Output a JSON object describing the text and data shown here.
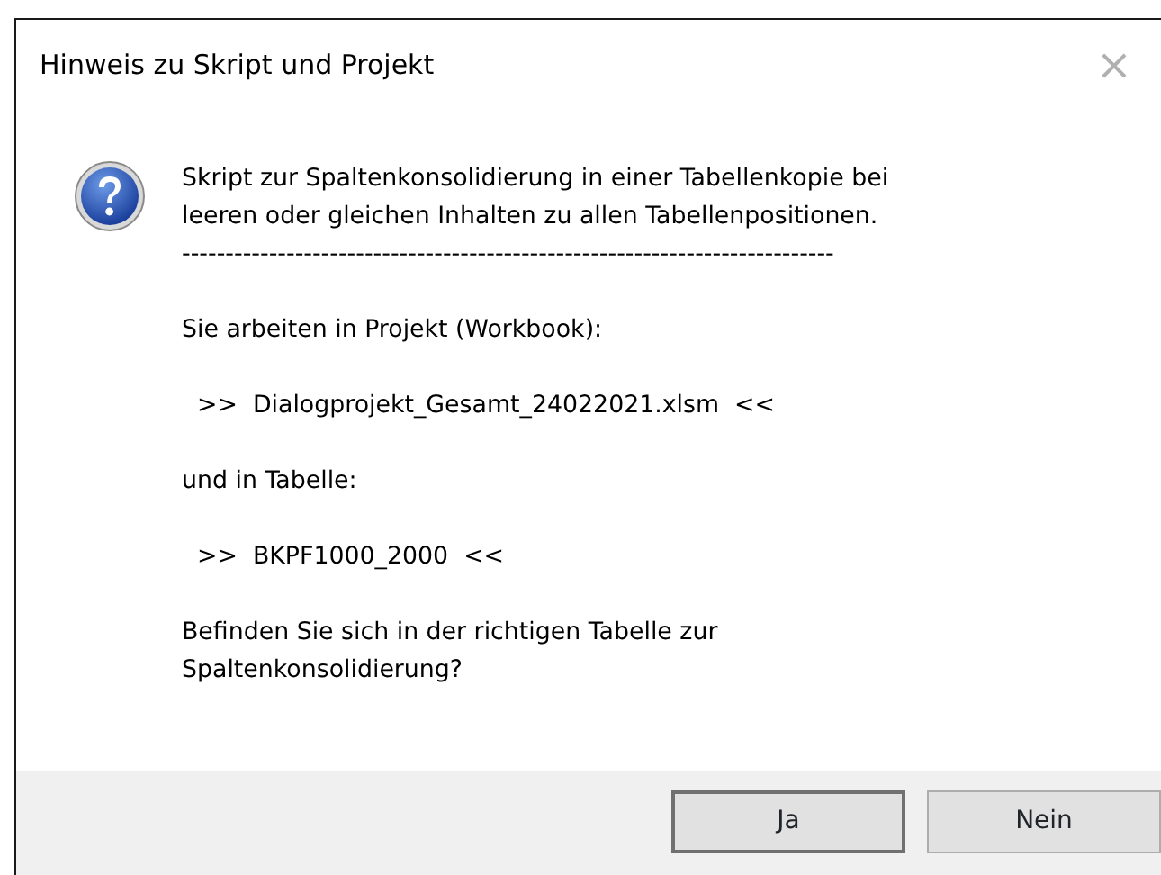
{
  "window": {
    "title": "Hinweis zu Skript und Projekt",
    "close": "×"
  },
  "message": [
    "Skript zur Spaltenkonsolidierung in einer Tabellenkopie bei leeren oder gleichen Inhalten zu allen Tabellenpositionen.",
    "---------------------------------------------------------------------------",
    "Sie arbeiten in Projekt (Workbook):",
    "  >>  Dialogprojekt_Gesamt_24022021.xlsm  <<",
    "und in Tabelle:",
    "  >>  BKPF1000_2000  <<",
    "Befinden Sie sich in der richtigen Tabelle zur Spaltenkonsolidierung?"
  ],
  "buttons": [
    {
      "label": "Ja",
      "default": true
    },
    {
      "label": "Nein",
      "default": false
    }
  ]
}
